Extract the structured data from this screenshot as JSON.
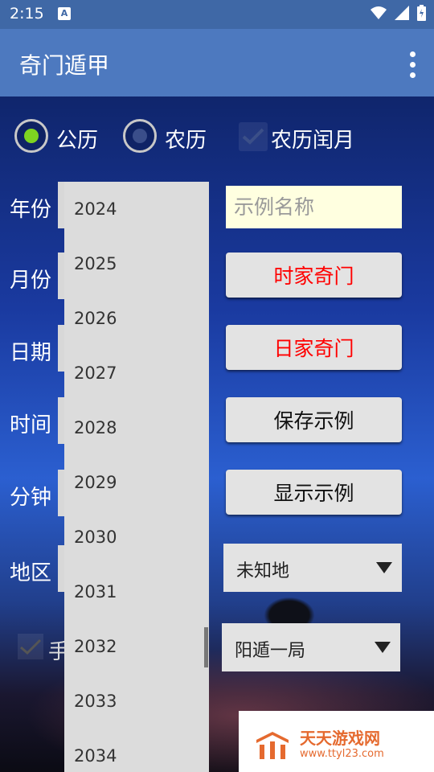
{
  "status_bar": {
    "time": "2:15",
    "notif_icon": "A"
  },
  "app_bar": {
    "title": "奇门遁甲"
  },
  "calendar": {
    "solar_label": "公历",
    "lunar_label": "农历",
    "leap_label": "农历闰月",
    "selected": "公历"
  },
  "fields": {
    "year": "年份",
    "month": "月份",
    "day": "日期",
    "hour": "时间",
    "minute": "分钟",
    "region": "地区",
    "hand": "手"
  },
  "year_list": [
    "2024",
    "2025",
    "2026",
    "2027",
    "2028",
    "2029",
    "2030",
    "2031",
    "2032",
    "2033",
    "2034"
  ],
  "name_input": {
    "placeholder": "示例名称",
    "value": ""
  },
  "buttons": {
    "hour_qimen": "时家奇门",
    "day_qimen": "日家奇门",
    "save_example": "保存示例",
    "show_example": "显示示例"
  },
  "spinners": {
    "region": "未知地",
    "ju": "阳遁一局"
  },
  "watermark": {
    "brand": "天天游戏网",
    "url": "www.ttyl23.com"
  },
  "colors": {
    "accent_red": "#ff0000",
    "radio_selected": "#7ed321",
    "app_bar": "#4d79bf"
  }
}
